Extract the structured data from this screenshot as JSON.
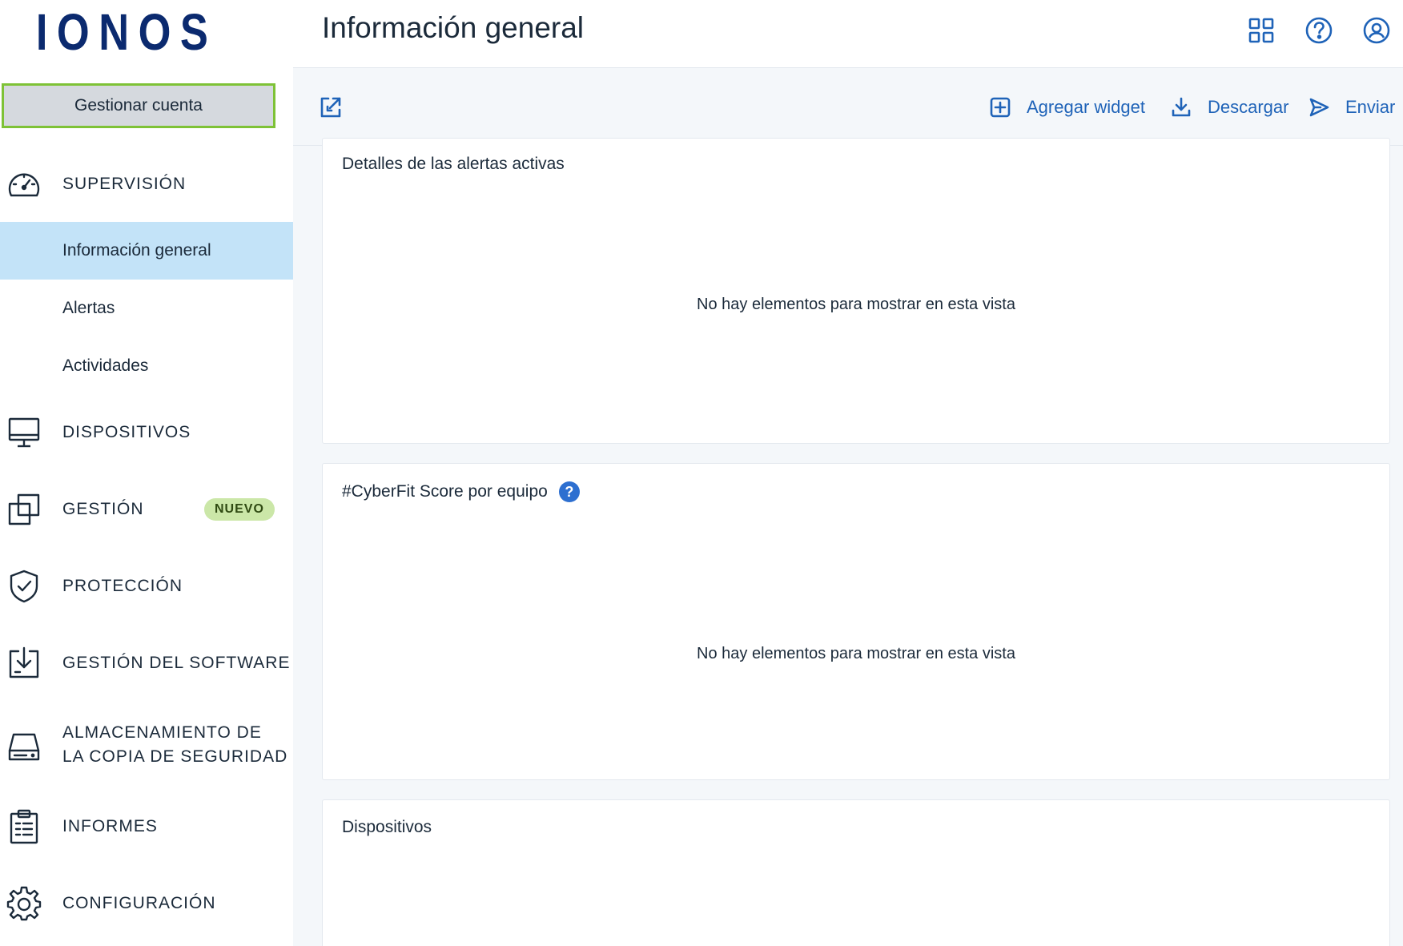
{
  "brand": {
    "logo_text": "IONOS",
    "color": "#0b2a6f"
  },
  "sidebar": {
    "manage_account_label": "Gestionar cuenta",
    "sections": [
      {
        "label": "SUPERVISIÓN",
        "icon": "dashboard-gauge-icon"
      },
      {
        "label": "DISPOSITIVOS",
        "icon": "monitor-icon"
      },
      {
        "label": "GESTIÓN",
        "icon": "layers-icon",
        "badge": "NUEVO"
      },
      {
        "label": "PROTECCIÓN",
        "icon": "shield-check-icon"
      },
      {
        "label": "GESTIÓN DEL SOFTWARE",
        "icon": "software-download-icon"
      },
      {
        "label": "ALMACENAMIENTO DE LA COPIA DE SEGURIDAD",
        "label_line1": "ALMACENAMIENTO DE",
        "label_line2": "LA COPIA DE SEGURIDAD",
        "icon": "storage-drive-icon"
      },
      {
        "label": "INFORMES",
        "icon": "clipboard-report-icon"
      },
      {
        "label": "CONFIGURACIÓN",
        "icon": "gear-icon"
      }
    ],
    "sub_items": [
      {
        "label": "Información general",
        "active": true
      },
      {
        "label": "Alertas",
        "active": false
      },
      {
        "label": "Actividades",
        "active": false
      }
    ],
    "active_color": "#c3e3f8",
    "badge_color": "#cbe7a8"
  },
  "header": {
    "title": "Información general",
    "icons": [
      "apps-grid-icon",
      "help-icon",
      "user-account-icon"
    ]
  },
  "toolbar": {
    "expand_icon": "expand-icon",
    "actions": [
      {
        "label": "Agregar widget",
        "icon": "add-square-icon"
      },
      {
        "label": "Descargar",
        "icon": "download-icon"
      },
      {
        "label": "Enviar",
        "icon": "send-icon"
      }
    ],
    "accent_color": "#1f63b8"
  },
  "widgets": [
    {
      "title": "Detalles de las alertas activas",
      "empty_text": "No hay elementos para mostrar en esta vista"
    },
    {
      "title": "#CyberFit Score por equipo",
      "empty_text": "No hay elementos para mostrar en esta vista",
      "help": "?"
    },
    {
      "title": "Dispositivos"
    }
  ]
}
